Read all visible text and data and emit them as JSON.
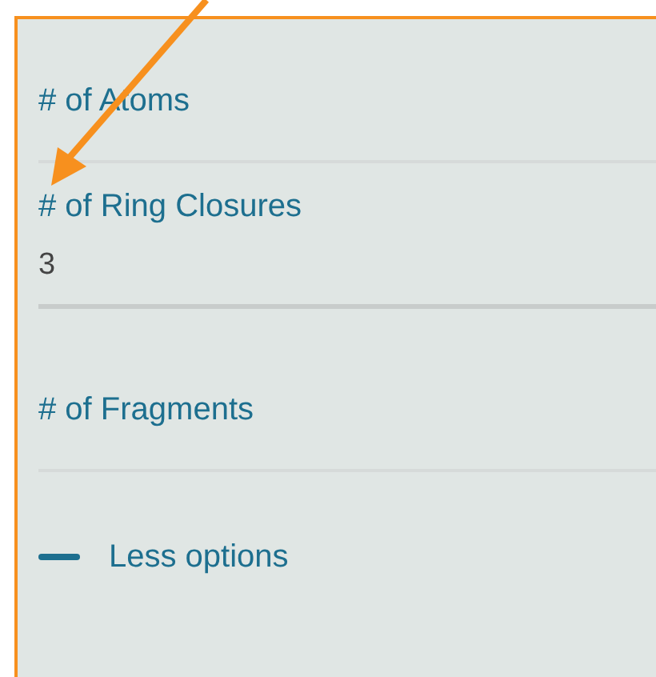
{
  "filters": [
    {
      "label": "# of Atoms"
    },
    {
      "label": "# of Ring Closures",
      "value": "3"
    },
    {
      "label": "# of Fragments"
    }
  ],
  "toggle": {
    "label": "Less options"
  }
}
